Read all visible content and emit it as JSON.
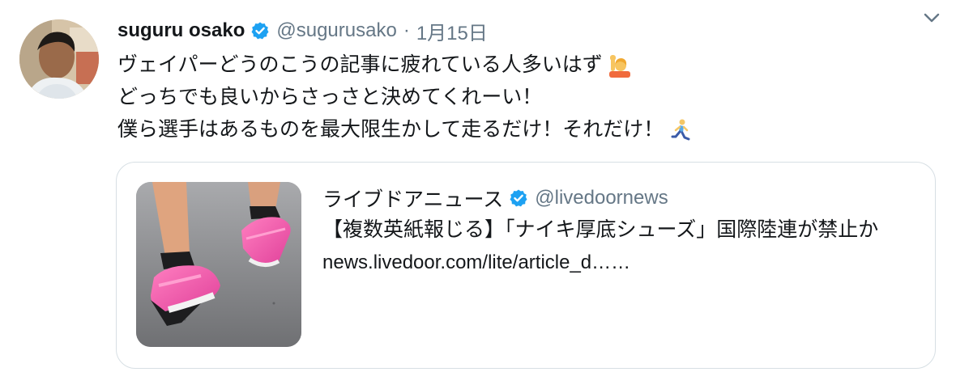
{
  "tweet": {
    "author_name": "suguru osako",
    "author_handle": "@sugurusako",
    "separator": "·",
    "date": "1月15日",
    "lines": [
      "ヴェイパーどうのこうの記事に疲れている人多いはず",
      "どっちでも良いからさっさと決めてくれーい！",
      "僕ら選手はあるものを最大限生かして走るだけ！それだけ！"
    ],
    "icons": {
      "verified": "verified-badge-icon",
      "chevron": "chevron-down-icon",
      "emoji_1": "person-raising-hand-emoji",
      "emoji_2": "person-running-emoji"
    }
  },
  "card": {
    "source_name": "ライブドアニュース",
    "source_handle": "@livedoornews",
    "title": "【複数英紙報じる】「ナイキ厚底シューズ」国際陸連が禁止か",
    "link": "news.livedoor.com/lite/article_d……"
  },
  "colors": {
    "text": "#14171a",
    "secondary": "#657786",
    "verified": "#1da1f2",
    "border": "#d7dfe4"
  }
}
